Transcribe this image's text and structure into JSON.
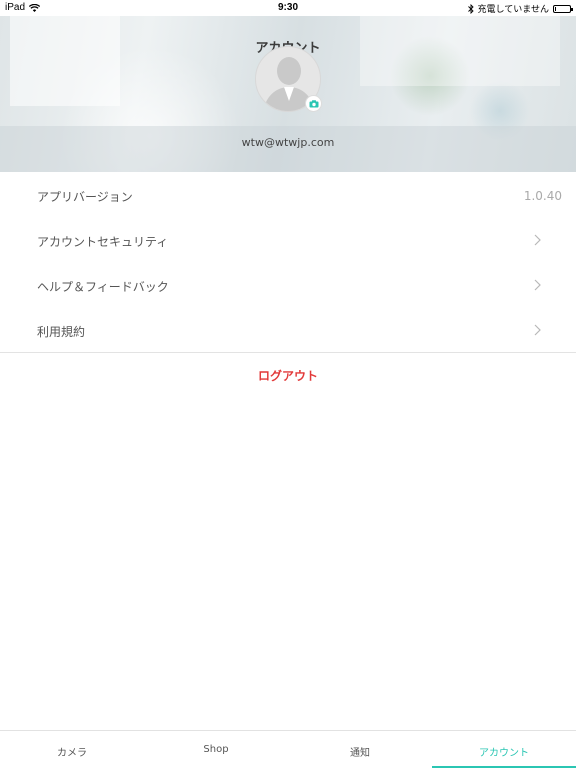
{
  "status_bar": {
    "device": "iPad",
    "time": "9:30",
    "charging": "充電していません"
  },
  "header": {
    "title": "アカウント",
    "email": "wtw@wtwjp.com"
  },
  "menu": {
    "items": [
      {
        "label": "アプリバージョン",
        "value": "1.0.40"
      },
      {
        "label": "アカウントセキュリティ"
      },
      {
        "label": "ヘルプ＆フィードバック"
      },
      {
        "label": "利用規約"
      }
    ]
  },
  "logout_label": "ログアウト",
  "tabbar": {
    "tabs": [
      {
        "label": "カメラ"
      },
      {
        "label": "Shop"
      },
      {
        "label": "通知"
      },
      {
        "label": "アカウント",
        "active": true
      }
    ]
  },
  "colors": {
    "accent": "#2bc6b3",
    "logout": "#e23a3a"
  },
  "battery_level": 0.1
}
